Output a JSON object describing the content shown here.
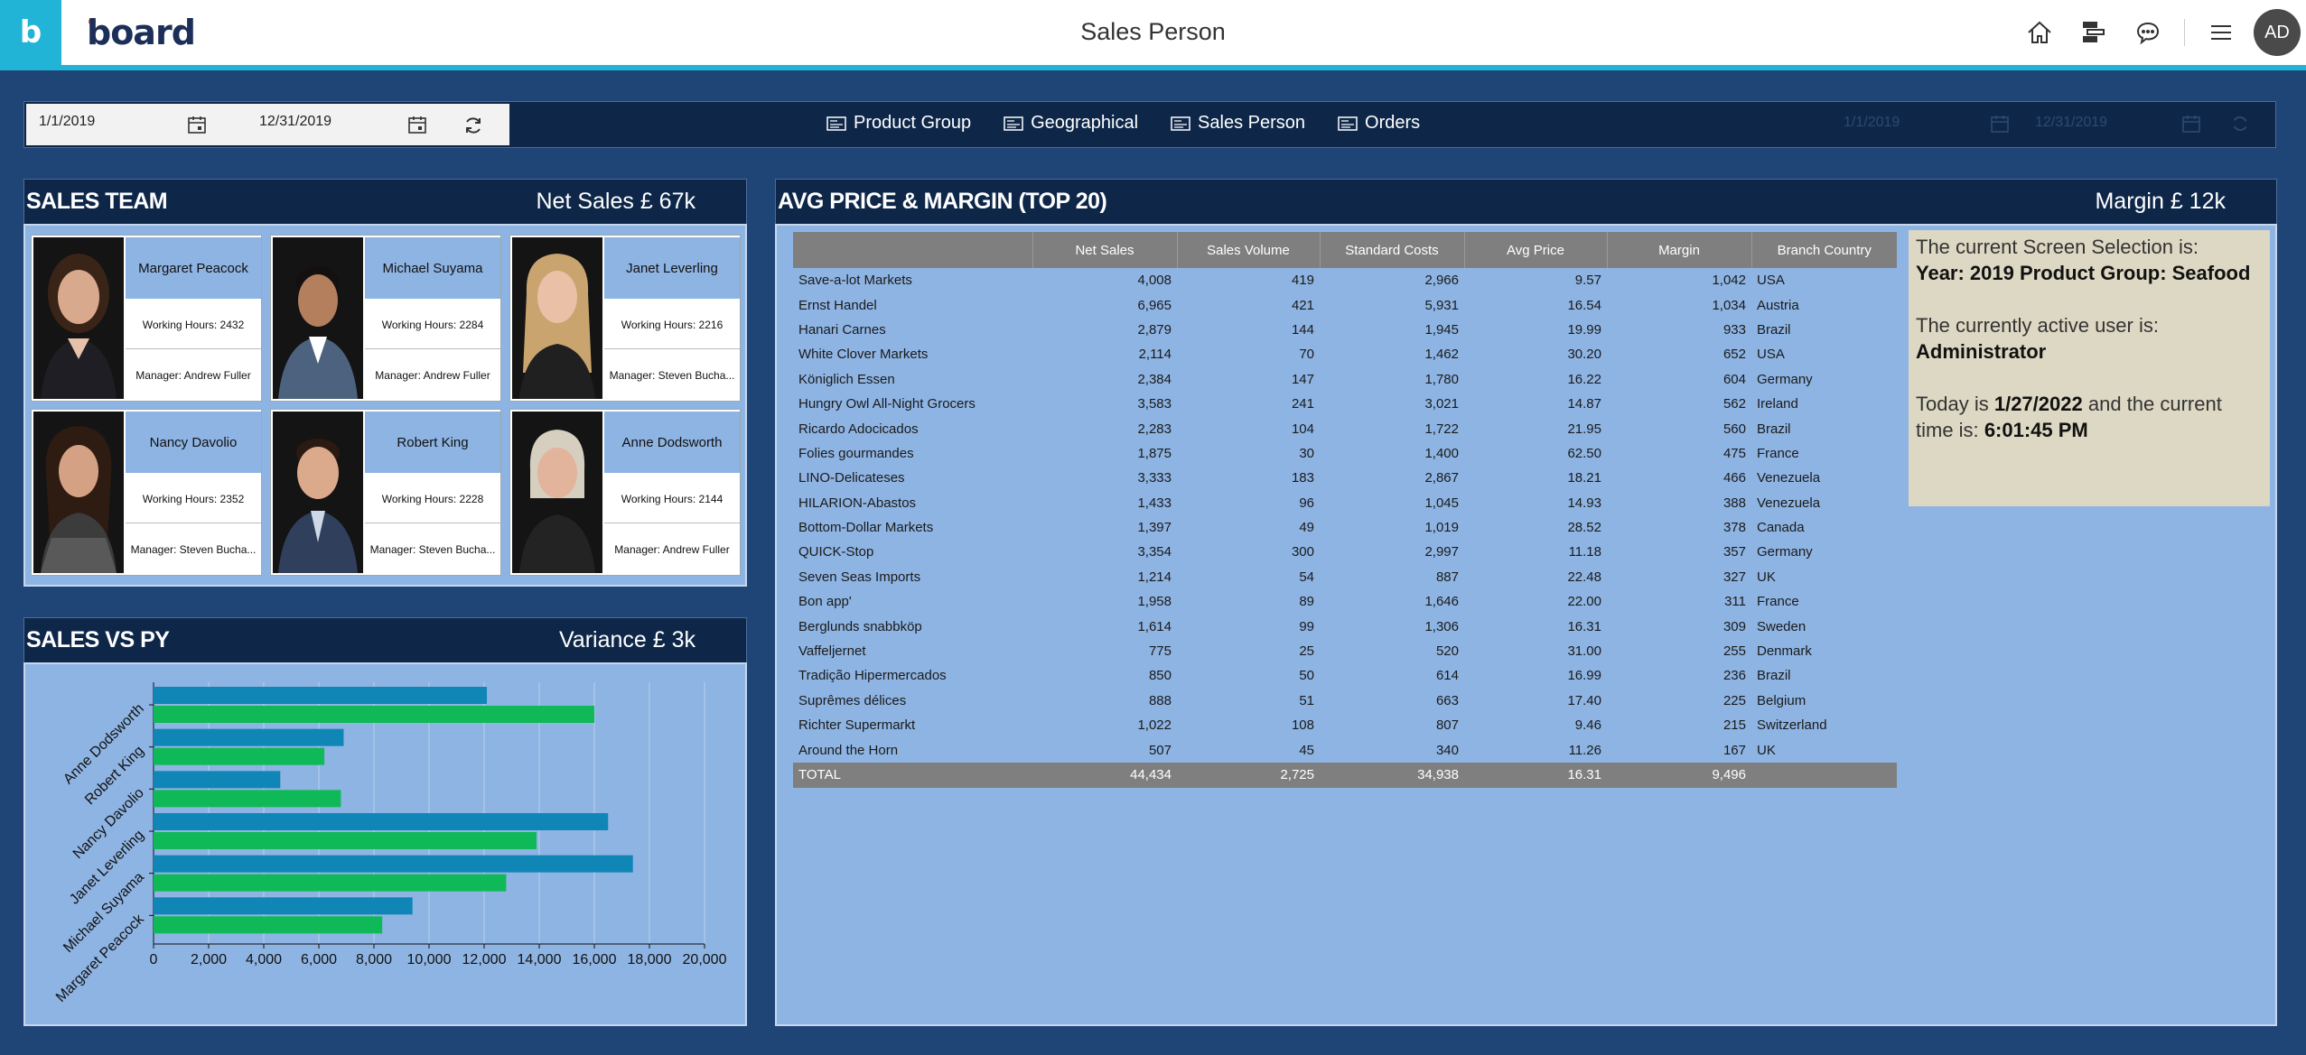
{
  "app": {
    "logo_letter": "b",
    "logo_text": "board",
    "page_title": "Sales Person",
    "avatar_initials": "AD"
  },
  "selection_bar": {
    "start_date": "1/1/2019",
    "end_date": "12/31/2019",
    "tabs": [
      {
        "label": "Product Group"
      },
      {
        "label": "Geographical"
      },
      {
        "label": "Sales Person"
      },
      {
        "label": "Orders"
      }
    ],
    "ghost_start_date": "1/1/2019",
    "ghost_end_date": "12/31/2019"
  },
  "sales_team": {
    "title": "SALES TEAM",
    "kpi": "Net Sales £ 67k",
    "people": [
      {
        "name": "Margaret Peacock",
        "hours": "Working Hours: 2432",
        "manager": "Manager: Andrew Fuller"
      },
      {
        "name": "Michael Suyama",
        "hours": "Working Hours: 2284",
        "manager": "Manager: Andrew Fuller"
      },
      {
        "name": "Janet Leverling",
        "hours": "Working Hours: 2216",
        "manager": "Manager: Steven Bucha..."
      },
      {
        "name": "Nancy Davolio",
        "hours": "Working Hours: 2352",
        "manager": "Manager: Steven Bucha..."
      },
      {
        "name": "Robert King",
        "hours": "Working Hours: 2228",
        "manager": "Manager: Steven Bucha..."
      },
      {
        "name": "Anne Dodsworth",
        "hours": "Working Hours: 2144",
        "manager": "Manager: Andrew Fuller"
      }
    ]
  },
  "sales_vs_py": {
    "title": "SALES VS PY",
    "kpi": "Variance £ 3k"
  },
  "chart_data": {
    "type": "bar",
    "orientation": "horizontal",
    "categories": [
      "Anne Dodsworth",
      "Robert King",
      "Nancy Davolio",
      "Janet Leverling",
      "Michael Suyama",
      "Margaret Peacock"
    ],
    "series": [
      {
        "color": "#0f86b6",
        "values": [
          12100,
          6900,
          4600,
          16500,
          17400,
          9400
        ]
      },
      {
        "color": "#10b957",
        "values": [
          16000,
          6200,
          6800,
          13900,
          12800,
          8300
        ]
      }
    ],
    "xlim": [
      0,
      20000
    ],
    "xticks": [
      "0",
      "2,000",
      "4,000",
      "6,000",
      "8,000",
      "10,000",
      "12,000",
      "14,000",
      "16,000",
      "18,000",
      "20,000"
    ],
    "grid": true
  },
  "avg_price": {
    "title": "AVG PRICE & MARGIN (TOP 20)",
    "kpi": "Margin £ 12k",
    "columns": [
      "",
      "Net Sales",
      "Sales Volume",
      "Standard Costs",
      "Avg Price",
      "Margin",
      "Branch Country"
    ],
    "rows": [
      [
        "Save-a-lot Markets",
        "4,008",
        "419",
        "2,966",
        "9.57",
        "1,042",
        "USA"
      ],
      [
        "Ernst Handel",
        "6,965",
        "421",
        "5,931",
        "16.54",
        "1,034",
        "Austria"
      ],
      [
        "Hanari Carnes",
        "2,879",
        "144",
        "1,945",
        "19.99",
        "933",
        "Brazil"
      ],
      [
        "White Clover Markets",
        "2,114",
        "70",
        "1,462",
        "30.20",
        "652",
        "USA"
      ],
      [
        "Königlich Essen",
        "2,384",
        "147",
        "1,780",
        "16.22",
        "604",
        "Germany"
      ],
      [
        "Hungry Owl All-Night Grocers",
        "3,583",
        "241",
        "3,021",
        "14.87",
        "562",
        "Ireland"
      ],
      [
        "Ricardo Adocicados",
        "2,283",
        "104",
        "1,722",
        "21.95",
        "560",
        "Brazil"
      ],
      [
        "Folies gourmandes",
        "1,875",
        "30",
        "1,400",
        "62.50",
        "475",
        "France"
      ],
      [
        "LINO-Delicateses",
        "3,333",
        "183",
        "2,867",
        "18.21",
        "466",
        "Venezuela"
      ],
      [
        "HILARION-Abastos",
        "1,433",
        "96",
        "1,045",
        "14.93",
        "388",
        "Venezuela"
      ],
      [
        "Bottom-Dollar Markets",
        "1,397",
        "49",
        "1,019",
        "28.52",
        "378",
        "Canada"
      ],
      [
        "QUICK-Stop",
        "3,354",
        "300",
        "2,997",
        "11.18",
        "357",
        "Germany"
      ],
      [
        "Seven Seas Imports",
        "1,214",
        "54",
        "887",
        "22.48",
        "327",
        "UK"
      ],
      [
        "Bon app'",
        "1,958",
        "89",
        "1,646",
        "22.00",
        "311",
        "France"
      ],
      [
        "Berglunds snabbköp",
        "1,614",
        "99",
        "1,306",
        "16.31",
        "309",
        "Sweden"
      ],
      [
        "Vaffeljernet",
        "775",
        "25",
        "520",
        "31.00",
        "255",
        "Denmark"
      ],
      [
        "Tradição Hipermercados",
        "850",
        "50",
        "614",
        "16.99",
        "236",
        "Brazil"
      ],
      [
        "Suprêmes délices",
        "888",
        "51",
        "663",
        "17.40",
        "225",
        "Belgium"
      ],
      [
        "Richter Supermarkt",
        "1,022",
        "108",
        "807",
        "9.46",
        "215",
        "Switzerland"
      ],
      [
        "Around the Horn",
        "507",
        "45",
        "340",
        "11.26",
        "167",
        "UK"
      ]
    ],
    "total": [
      "TOTAL",
      "44,434",
      "2,725",
      "34,938",
      "16.31",
      "9,496",
      ""
    ]
  },
  "info": {
    "selection_label": "The current Screen Selection is:",
    "selection_value": "Year: 2019 Product Group: Seafood",
    "user_label": "The currently active user is:",
    "user_value": "Administrator",
    "today_prefix": "Today is",
    "today_date": "1/27/2022",
    "time_middle": "and the current time is:",
    "time_value": "6:01:45 PM"
  }
}
